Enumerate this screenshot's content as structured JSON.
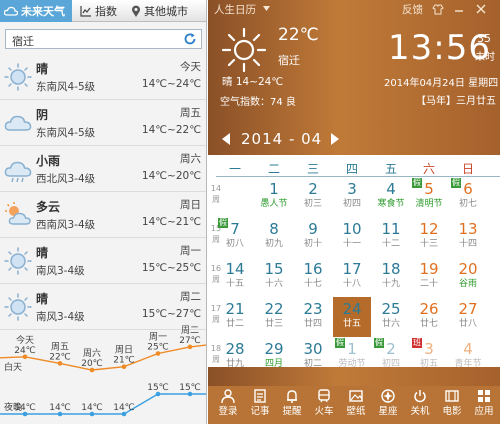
{
  "left": {
    "tabs": [
      {
        "label": "未来天气",
        "icon": "cloud-icon"
      },
      {
        "label": "指数",
        "icon": "chart-icon"
      },
      {
        "label": "其他城市",
        "icon": "location-pin-icon"
      }
    ],
    "search": {
      "value": "宿迁",
      "icon": "refresh-icon"
    },
    "forecast": [
      {
        "cond": "晴",
        "wind": "东南风4-5级",
        "day": "今天",
        "temp": "14℃~24℃",
        "icon": "sun-icon"
      },
      {
        "cond": "阴",
        "wind": "东南风4-5级",
        "day": "周五",
        "temp": "14℃~22℃",
        "icon": "cloud-icon"
      },
      {
        "cond": "小雨",
        "wind": "西北风3-4级",
        "day": "周六",
        "temp": "14℃~20℃",
        "icon": "rain-icon"
      },
      {
        "cond": "多云",
        "wind": "西南风3-4级",
        "day": "周日",
        "temp": "14℃~21℃",
        "icon": "partly-cloudy-icon"
      },
      {
        "cond": "晴",
        "wind": "南风3-4级",
        "day": "周一",
        "temp": "15℃~25℃",
        "icon": "sun-icon"
      },
      {
        "cond": "晴",
        "wind": "南风3-4级",
        "day": "周二",
        "temp": "15℃~27℃",
        "icon": "sun-icon"
      }
    ],
    "chart_data": {
      "type": "line",
      "categories": [
        "今天",
        "周五",
        "周六",
        "周日",
        "周一",
        "周二"
      ],
      "series": [
        {
          "name": "白天",
          "values": [
            24,
            22,
            20,
            21,
            25,
            27
          ],
          "color": "#f08a24"
        },
        {
          "name": "夜晚",
          "values": [
            14,
            14,
            14,
            14,
            15,
            15
          ],
          "color": "#3aa0e0"
        }
      ],
      "day_labels": [
        "24℃",
        "22℃",
        "20℃",
        "21℃",
        "25℃",
        "27℃"
      ],
      "night_labels": [
        "14℃",
        "14℃",
        "14℃",
        "14℃",
        "15℃",
        "15℃"
      ]
    }
  },
  "right": {
    "topbar": {
      "title": "人生日历",
      "feedback": "反馈"
    },
    "current": {
      "temp": "22℃",
      "location": "宿迁",
      "today_temp": "晴 14~24℃",
      "aqi": "空气指数：74 良"
    },
    "clock": {
      "time": "13:56",
      "seconds": "35",
      "seconds_label": "未时"
    },
    "date": {
      "date": "2014年04月24日 星期四",
      "lunar": "【马年】三月廿五"
    },
    "month": {
      "label": "2014 - 04"
    },
    "weekdays": [
      "一",
      "二",
      "三",
      "四",
      "五",
      "六",
      "日"
    ],
    "weeks": [
      "14周",
      "15周",
      "16周",
      "17周",
      "18周"
    ],
    "days": [
      {
        "n": "",
        "l": ""
      },
      {
        "n": "1",
        "l": "愚人节",
        "lc": "#2a9a2a"
      },
      {
        "n": "2",
        "l": "初三"
      },
      {
        "n": "3",
        "l": "初四"
      },
      {
        "n": "4",
        "l": "寒食节",
        "lc": "#2a9a2a"
      },
      {
        "n": "5",
        "l": "清明节",
        "lc": "#2a9a2a",
        "b": "假"
      },
      {
        "n": "6",
        "l": "初七",
        "b": "假"
      },
      {
        "n": "7",
        "l": "初八",
        "b": "假"
      },
      {
        "n": "8",
        "l": "初九"
      },
      {
        "n": "9",
        "l": "初十"
      },
      {
        "n": "10",
        "l": "十一"
      },
      {
        "n": "11",
        "l": "十二"
      },
      {
        "n": "12",
        "l": "十三"
      },
      {
        "n": "13",
        "l": "十四"
      },
      {
        "n": "14",
        "l": "十五"
      },
      {
        "n": "15",
        "l": "十六"
      },
      {
        "n": "16",
        "l": "十七"
      },
      {
        "n": "17",
        "l": "十八"
      },
      {
        "n": "18",
        "l": "十九"
      },
      {
        "n": "19",
        "l": "二十"
      },
      {
        "n": "20",
        "l": "谷雨",
        "lc": "#2a9a2a"
      },
      {
        "n": "21",
        "l": "廿二"
      },
      {
        "n": "22",
        "l": "廿三"
      },
      {
        "n": "23",
        "l": "廿四"
      },
      {
        "n": "24",
        "l": "廿五",
        "today": true
      },
      {
        "n": "25",
        "l": "廿六"
      },
      {
        "n": "26",
        "l": "廿七"
      },
      {
        "n": "27",
        "l": "廿八"
      },
      {
        "n": "28",
        "l": "廿九"
      },
      {
        "n": "29",
        "l": "四月",
        "lc": "#2a9a2a"
      },
      {
        "n": "30",
        "l": "初二"
      },
      {
        "n": "1",
        "l": "劳动节",
        "b": "假",
        "dim": true
      },
      {
        "n": "2",
        "l": "初四",
        "b": "假",
        "dim": true
      },
      {
        "n": "3",
        "l": "初五",
        "b": "班",
        "bred": true,
        "dim": true
      },
      {
        "n": "4",
        "l": "青年节",
        "dim": true
      }
    ],
    "bottom": [
      {
        "label": "登录",
        "icon": "user-icon"
      },
      {
        "label": "记事",
        "icon": "note-icon"
      },
      {
        "label": "提醒",
        "icon": "bell-icon"
      },
      {
        "label": "火车",
        "icon": "train-icon"
      },
      {
        "label": "壁纸",
        "icon": "wallpaper-icon"
      },
      {
        "label": "星座",
        "icon": "zodiac-icon"
      },
      {
        "label": "关机",
        "icon": "power-icon"
      },
      {
        "label": "电影",
        "icon": "film-icon"
      },
      {
        "label": "应用",
        "icon": "apps-icon"
      }
    ]
  }
}
